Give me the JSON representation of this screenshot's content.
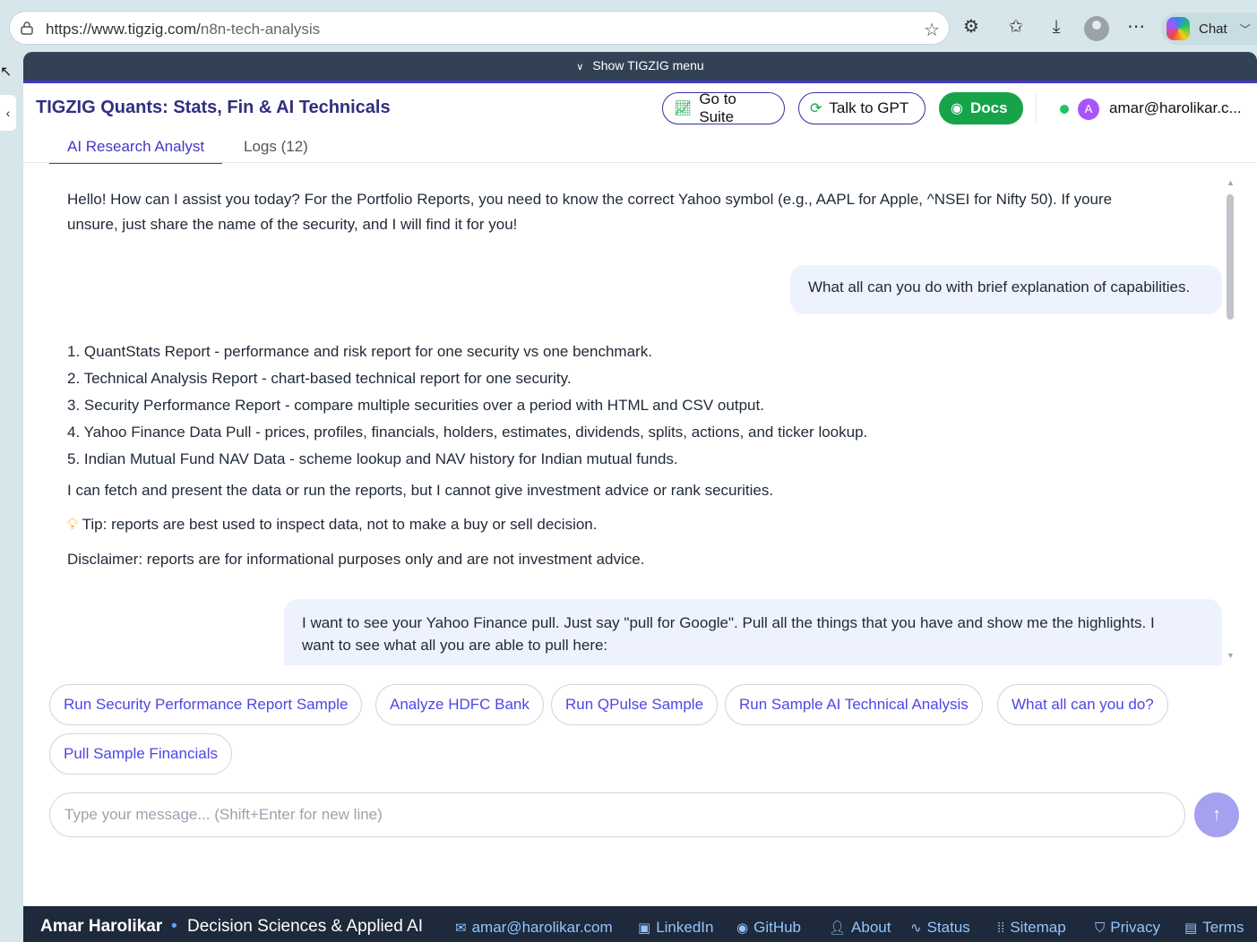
{
  "browser": {
    "url_host": "https://www.tigzig.com/",
    "url_path": "n8n-tech-analysis",
    "chat_label": "Chat"
  },
  "menu": {
    "label": "Show TIGZIG menu"
  },
  "header": {
    "title": "TIGZIG Quants: Stats, Fin & AI Technicals",
    "go_to_suite": "Go to Suite",
    "talk_to_gpt": "Talk to GPT",
    "docs": "Docs",
    "user_initial": "A",
    "user_email": "amar@harolikar.c..."
  },
  "tabs": [
    {
      "label": "AI Research Analyst",
      "active": true
    },
    {
      "label": "Logs (12)",
      "active": false
    }
  ],
  "chat": {
    "greeting_line1": "Hello! How can I assist you today? For the Portfolio Reports, you need to know the correct Yahoo symbol (e.g., AAPL for Apple, ^NSEI for Nifty 50). If youre",
    "greeting_line2": "unsure, just share the name of the security, and I will find it for you!",
    "user_q1": "What all can you do with brief explanation of capabilities.",
    "capabilities": [
      "1. QuantStats Report - performance and risk report for one security vs one benchmark.",
      "2. Technical Analysis Report - chart-based technical report for one security.",
      "3. Security Performance Report - compare multiple securities over a period with HTML and CSV output.",
      "4. Yahoo Finance Data Pull - prices, profiles, financials, holders, estimates, dividends, splits, actions, and ticker lookup.",
      "5. Indian Mutual Fund NAV Data - scheme lookup and NAV history for Indian mutual funds."
    ],
    "fetch_note": "I can fetch and present the data or run the reports, but I cannot give investment advice or rank securities.",
    "tip": "Tip: reports are best used to inspect data, not to make a buy or sell decision.",
    "disclaimer": "Disclaimer: reports are for informational purposes only and are not investment advice.",
    "user_q2_line1": "I want to see your Yahoo Finance pull. Just say \"pull for Google\". Pull all the things that you have and show me the highlights. I",
    "user_q2_line2": "want to see what all you are able to pull here:"
  },
  "suggestions": [
    "Run Security Performance Report Sample",
    "Analyze HDFC Bank",
    "Run QPulse Sample",
    "Run Sample AI Technical Analysis",
    "What all can you do?",
    "Pull Sample Financials"
  ],
  "input": {
    "placeholder": "Type your message... (Shift+Enter for new line)"
  },
  "footer": {
    "name": "Amar Harolikar",
    "tagline": "Decision Sciences & Applied AI",
    "email": "amar@harolikar.com",
    "links": [
      "LinkedIn",
      "GitHub",
      "About",
      "Status",
      "Sitemap",
      "Privacy",
      "Terms"
    ]
  },
  "colors": {
    "accent": "#4338ca",
    "docs_green": "#16a34a",
    "footer_bg": "#1e293b",
    "bubble_bg": "#eef2ff"
  }
}
